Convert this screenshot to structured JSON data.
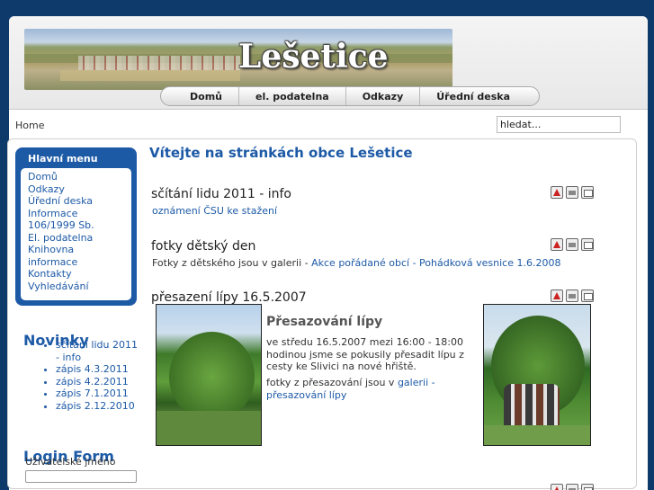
{
  "header": {
    "site_title": "Lešetice"
  },
  "topnav": [
    "Domů",
    "el. podatelna",
    "Odkazy",
    "Úřední deska"
  ],
  "breadcrumb": "Home",
  "search": {
    "value": "hledat..."
  },
  "main_menu": {
    "title": "Hlavní menu",
    "items": [
      "Domů",
      "Odkazy",
      "Úřední deska",
      "Informace 106/1999 Sb.",
      "El. podatelna",
      "Knihovna",
      "informace",
      "Kontakty",
      "Vyhledávání"
    ]
  },
  "news": {
    "title": "Novinky",
    "items": [
      "sčítání lidu 2011 - info",
      "zápis 4.3.2011",
      "zápis 4.2.2011",
      "zápis 7.1.2011",
      "zápis 2.12.2010"
    ]
  },
  "login": {
    "title": "Login Form",
    "username_label": "Uživatelské jméno"
  },
  "welcome": "Vítejte na stránkách obce Lešetice",
  "articles": [
    {
      "title": "sčítání lidu 2011 - info",
      "text_link": "oznámení ČSU ke stažení"
    },
    {
      "title": "fotky dětský den",
      "text": "Fotky z dětského jsou v galerii - ",
      "link": "Akce pořádané obcí - Pohádková vesnice 1.6.2008"
    },
    {
      "title": "přesazení lípy 16.5.2007",
      "subtitle": "Přesazování lípy",
      "p1": "ve středu 16.5.2007 mezi 16:00 - 18:00 hodinou jsme se pokusily přesadit lípu z cesty ke Slivici na nové hřiště.",
      "p2_text": "fotky z přesazování jsou v ",
      "p2_link": "galerii - přesazování lípy"
    }
  ],
  "icons": [
    "pdf-icon",
    "print-icon",
    "email-icon"
  ]
}
